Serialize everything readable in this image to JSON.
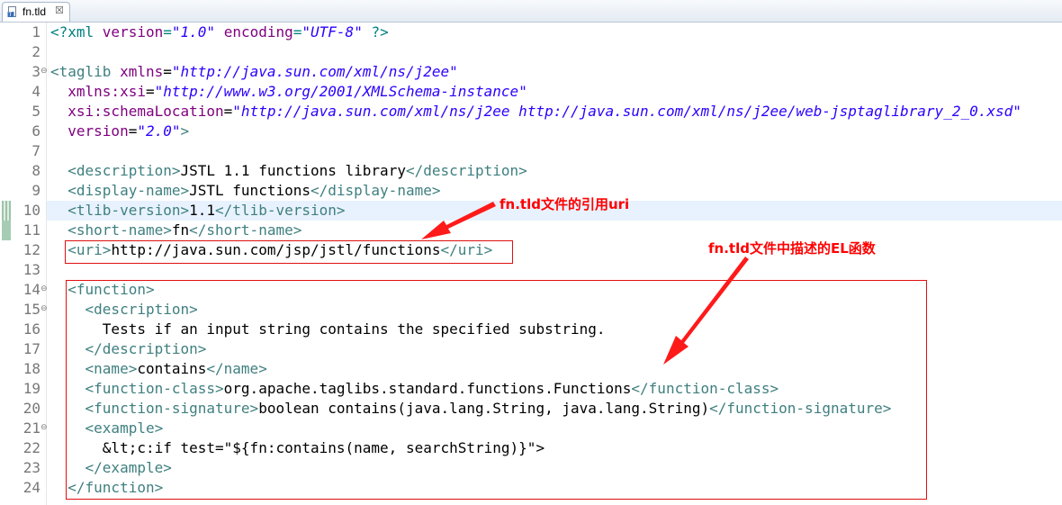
{
  "tab": {
    "title": "fn.tld",
    "close_glyph": "☒",
    "icon": "tld-file-icon"
  },
  "editor": {
    "current_line": 10,
    "lines": [
      {
        "n": "1",
        "fold": "",
        "tokens": [
          [
            "pi",
            "<?xml "
          ],
          [
            "attr",
            "version"
          ],
          [
            "pi",
            "="
          ],
          [
            "str",
            "\"1.0\""
          ],
          [
            "pi",
            " "
          ],
          [
            "attr",
            "encoding"
          ],
          [
            "pi",
            "="
          ],
          [
            "str",
            "\"UTF-8\""
          ],
          [
            "pi",
            " ?>"
          ]
        ]
      },
      {
        "n": "2",
        "fold": "",
        "tokens": []
      },
      {
        "n": "3",
        "fold": "⊖",
        "tokens": [
          [
            "tag",
            "<taglib "
          ],
          [
            "attr",
            "xmlns"
          ],
          [
            "txt",
            "="
          ],
          [
            "str",
            "\"http://java.sun.com/xml/ns/j2ee\""
          ]
        ]
      },
      {
        "n": "4",
        "fold": "",
        "tokens": [
          [
            "txt",
            "  "
          ],
          [
            "attr",
            "xmlns:xsi"
          ],
          [
            "txt",
            "="
          ],
          [
            "str",
            "\"http://www.w3.org/2001/XMLSchema-instance\""
          ]
        ]
      },
      {
        "n": "5",
        "fold": "",
        "tokens": [
          [
            "txt",
            "  "
          ],
          [
            "attr",
            "xsi:schemaLocation"
          ],
          [
            "txt",
            "="
          ],
          [
            "str",
            "\"http://java.sun.com/xml/ns/j2ee http://java.sun.com/xml/ns/j2ee/web-jsptaglibrary_2_0.xsd\""
          ]
        ]
      },
      {
        "n": "6",
        "fold": "",
        "tokens": [
          [
            "txt",
            "  "
          ],
          [
            "attr",
            "version"
          ],
          [
            "txt",
            "="
          ],
          [
            "str",
            "\"2.0\""
          ],
          [
            "tag",
            ">"
          ]
        ]
      },
      {
        "n": "7",
        "fold": "",
        "tokens": []
      },
      {
        "n": "8",
        "fold": "",
        "tokens": [
          [
            "txt",
            "  "
          ],
          [
            "tag",
            "<description>"
          ],
          [
            "txt",
            "JSTL 1.1 functions library"
          ],
          [
            "tag",
            "</description>"
          ]
        ]
      },
      {
        "n": "9",
        "fold": "",
        "tokens": [
          [
            "txt",
            "  "
          ],
          [
            "tag",
            "<display-name>"
          ],
          [
            "txt",
            "JSTL functions"
          ],
          [
            "tag",
            "</display-name>"
          ]
        ]
      },
      {
        "n": "10",
        "fold": "",
        "tokens": [
          [
            "txt",
            "  "
          ],
          [
            "tag",
            "<tlib-version>"
          ],
          [
            "txt",
            "1.1"
          ],
          [
            "tag",
            "</tlib-version>"
          ]
        ]
      },
      {
        "n": "11",
        "fold": "",
        "tokens": [
          [
            "txt",
            "  "
          ],
          [
            "tag",
            "<short-name>"
          ],
          [
            "txt",
            "fn"
          ],
          [
            "tag",
            "</short-name>"
          ]
        ]
      },
      {
        "n": "12",
        "fold": "",
        "tokens": [
          [
            "txt",
            "  "
          ],
          [
            "tag",
            "<uri>"
          ],
          [
            "txt",
            "http://java.sun.com/jsp/jstl/functions"
          ],
          [
            "tag",
            "</uri>"
          ]
        ]
      },
      {
        "n": "13",
        "fold": "",
        "tokens": []
      },
      {
        "n": "14",
        "fold": "⊖",
        "tokens": [
          [
            "txt",
            "  "
          ],
          [
            "tag",
            "<function>"
          ]
        ]
      },
      {
        "n": "15",
        "fold": "⊖",
        "tokens": [
          [
            "txt",
            "    "
          ],
          [
            "tag",
            "<description>"
          ]
        ]
      },
      {
        "n": "16",
        "fold": "",
        "tokens": [
          [
            "txt",
            "      Tests if an input string contains the specified substring."
          ]
        ]
      },
      {
        "n": "17",
        "fold": "",
        "tokens": [
          [
            "txt",
            "    "
          ],
          [
            "tag",
            "</description>"
          ]
        ]
      },
      {
        "n": "18",
        "fold": "",
        "tokens": [
          [
            "txt",
            "    "
          ],
          [
            "tag",
            "<name>"
          ],
          [
            "txt",
            "contains"
          ],
          [
            "tag",
            "</name>"
          ]
        ]
      },
      {
        "n": "19",
        "fold": "",
        "tokens": [
          [
            "txt",
            "    "
          ],
          [
            "tag",
            "<function-class>"
          ],
          [
            "txt",
            "org.apache.taglibs.standard.functions.Functions"
          ],
          [
            "tag",
            "</function-class>"
          ]
        ]
      },
      {
        "n": "20",
        "fold": "",
        "tokens": [
          [
            "txt",
            "    "
          ],
          [
            "tag",
            "<function-signature>"
          ],
          [
            "txt",
            "boolean contains(java.lang.String, java.lang.String)"
          ],
          [
            "tag",
            "</function-signature>"
          ]
        ]
      },
      {
        "n": "21",
        "fold": "⊖",
        "tokens": [
          [
            "txt",
            "    "
          ],
          [
            "tag",
            "<example>"
          ]
        ]
      },
      {
        "n": "22",
        "fold": "",
        "tokens": [
          [
            "txt",
            "      &lt;c:if test=\"${fn:contains(name, searchString)}\">"
          ]
        ]
      },
      {
        "n": "23",
        "fold": "",
        "tokens": [
          [
            "txt",
            "    "
          ],
          [
            "tag",
            "</example>"
          ]
        ]
      },
      {
        "n": "24",
        "fold": "",
        "tokens": [
          [
            "txt",
            "  "
          ],
          [
            "tag",
            "</function>"
          ]
        ]
      }
    ]
  },
  "annotations": {
    "uri_note": "fn.tld文件的引用uri",
    "function_note": "fn.tld文件中描述的EL函数",
    "color": "#ff0000"
  }
}
